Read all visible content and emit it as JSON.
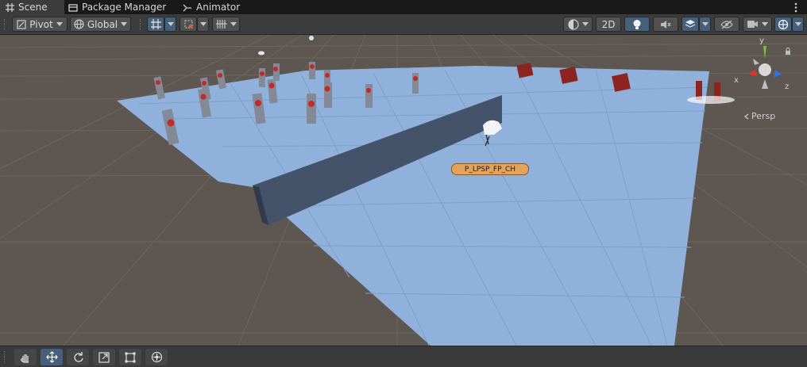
{
  "tabs": [
    {
      "label": "Scene",
      "icon": "grid-hash-icon",
      "active": true
    },
    {
      "label": "Package Manager",
      "icon": "package-icon",
      "active": false
    },
    {
      "label": "Animator",
      "icon": "animator-icon",
      "active": false
    }
  ],
  "toolbar": {
    "pivot_label": "Pivot",
    "global_label": "Global",
    "mode_2d_label": "2D"
  },
  "scene": {
    "object_label": "P_LPSP_FP_CH",
    "gizmo": {
      "y_axis": "y",
      "x_axis": "x",
      "z_axis": "z",
      "projection_label": "Persp"
    }
  },
  "bottom_tools": [
    "hand-tool",
    "move-tool",
    "rotate-tool",
    "scale-tool",
    "rect-tool",
    "transform-tool"
  ],
  "colors": {
    "accent": "#46607c",
    "floor": "#8fb1dc",
    "ground": "#5e5650",
    "gizmo_x": "#d7382e",
    "gizmo_y": "#7fc02f",
    "gizmo_z": "#3c6ee0"
  }
}
